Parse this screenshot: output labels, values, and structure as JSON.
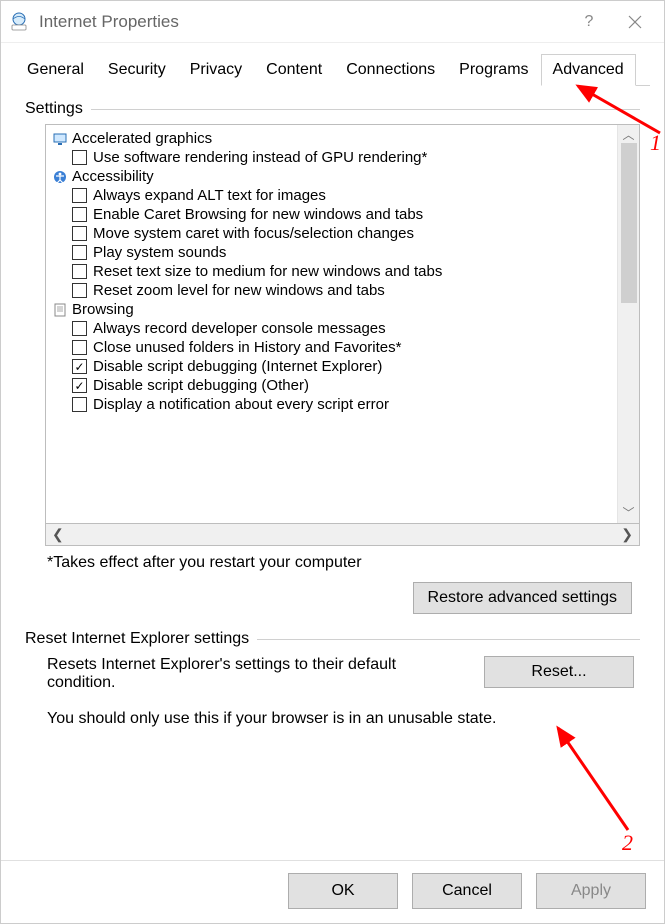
{
  "window": {
    "title": "Internet Properties"
  },
  "tabs": [
    "General",
    "Security",
    "Privacy",
    "Content",
    "Connections",
    "Programs",
    "Advanced"
  ],
  "active_tab": "Advanced",
  "settings_group_label": "Settings",
  "tree": [
    {
      "type": "cat",
      "icon": "monitor-icon",
      "label": "Accelerated graphics"
    },
    {
      "type": "opt",
      "checked": false,
      "label": "Use software rendering instead of GPU rendering*"
    },
    {
      "type": "cat",
      "icon": "accessibility-icon",
      "label": "Accessibility"
    },
    {
      "type": "opt",
      "checked": false,
      "label": "Always expand ALT text for images"
    },
    {
      "type": "opt",
      "checked": false,
      "label": "Enable Caret Browsing for new windows and tabs"
    },
    {
      "type": "opt",
      "checked": false,
      "label": "Move system caret with focus/selection changes"
    },
    {
      "type": "opt",
      "checked": false,
      "label": "Play system sounds"
    },
    {
      "type": "opt",
      "checked": false,
      "label": "Reset text size to medium for new windows and tabs"
    },
    {
      "type": "opt",
      "checked": false,
      "label": "Reset zoom level for new windows and tabs"
    },
    {
      "type": "cat",
      "icon": "page-icon",
      "label": "Browsing"
    },
    {
      "type": "opt",
      "checked": false,
      "label": "Always record developer console messages"
    },
    {
      "type": "opt",
      "checked": false,
      "label": "Close unused folders in History and Favorites*"
    },
    {
      "type": "opt",
      "checked": true,
      "label": "Disable script debugging (Internet Explorer)"
    },
    {
      "type": "opt",
      "checked": true,
      "label": "Disable script debugging (Other)"
    },
    {
      "type": "opt",
      "checked": false,
      "label": "Display a notification about every script error"
    }
  ],
  "footnote": "*Takes effect after you restart your computer",
  "restore_btn": "Restore advanced settings",
  "reset_group_label": "Reset Internet Explorer settings",
  "reset_desc": "Resets Internet Explorer's settings to their default condition.",
  "reset_btn": "Reset...",
  "reset_warn": "You should only use this if your browser is in an unusable state.",
  "buttons": {
    "ok": "OK",
    "cancel": "Cancel",
    "apply": "Apply"
  },
  "annotations": {
    "n1": "1",
    "n2": "2"
  }
}
